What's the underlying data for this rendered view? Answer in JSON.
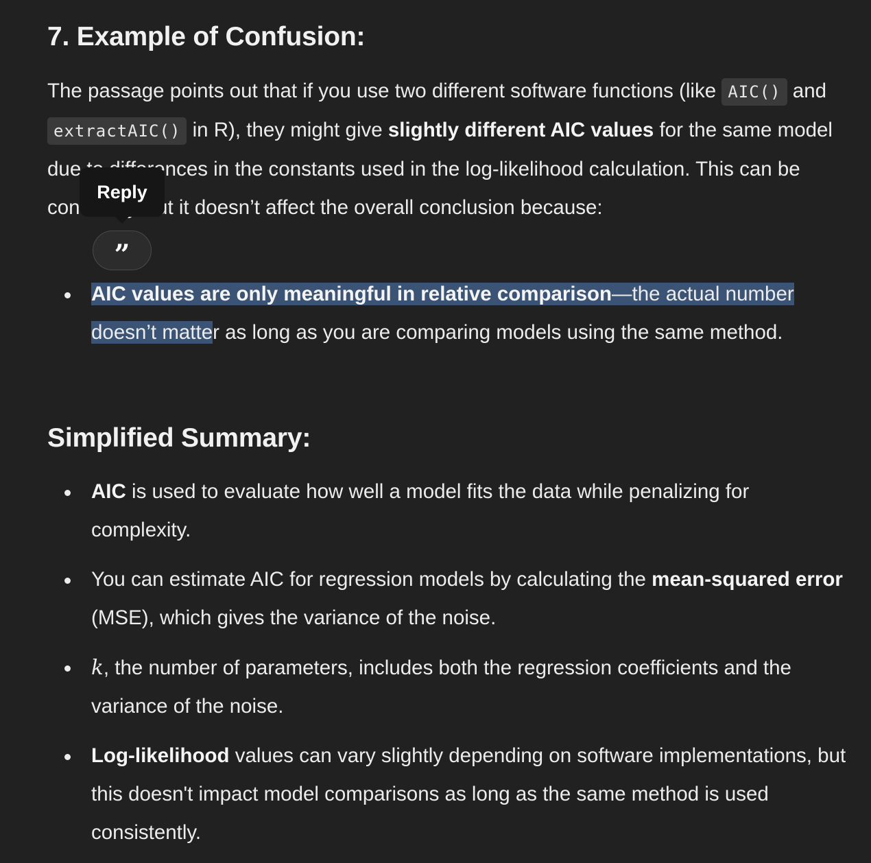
{
  "section7": {
    "heading": "7. Example of Confusion:",
    "para": {
      "t1": "The passage points out that if you use two different software functions (like ",
      "code1": "AIC()",
      "t2": " and ",
      "code2": "extractAIC()",
      "t3": " in R), they might give ",
      "bold1": "slightly different AIC values",
      "t4": " for the same model due to differences in the constants used in the log-likelihood calculation. This can be confusing, but it doesn’t affect the overall conclusion because:"
    },
    "bullet": {
      "bold": "AIC values are only meaningful in relative comparison",
      "sel_rest": "—the actual number doesn’t matte",
      "rest": "r as long as you are comparing models using the same method."
    }
  },
  "summary": {
    "heading": "Simplified Summary:",
    "items": [
      {
        "bold": "AIC",
        "text": " is used to evaluate how well a model fits the data while penalizing for complexity."
      },
      {
        "text_before": "You can estimate AIC for regression models by calculating the ",
        "bold": "mean-squared error",
        "text_after": " (MSE), which gives the variance of the noise."
      },
      {
        "math": "k",
        "text": ", the number of parameters, includes both the regression coefficients and the variance of the noise."
      },
      {
        "bold": "Log-likelihood",
        "text": " values can vary slightly depending on software implementations, but this doesn't impact model comparisons as long as the same method is used consistently."
      }
    ]
  },
  "popup": {
    "reply_label": "Reply",
    "quote_glyph": "”",
    "quote_icon": "quote-icon"
  },
  "colors": {
    "background": "#212121",
    "selection": "#3b5374",
    "code_bg": "#3a3a3a"
  }
}
